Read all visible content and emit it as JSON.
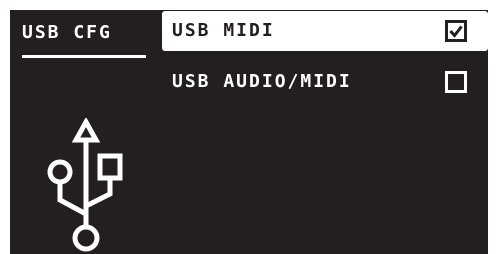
{
  "sidebar": {
    "title": "USB CFG",
    "icon": "usb-icon"
  },
  "menu": {
    "items": [
      {
        "label": "USB MIDI",
        "checked": true,
        "selected": true
      },
      {
        "label": "USB AUDIO/MIDI",
        "checked": false,
        "selected": false
      }
    ]
  },
  "colors": {
    "background": "#231f20",
    "foreground": "#ffffff"
  }
}
